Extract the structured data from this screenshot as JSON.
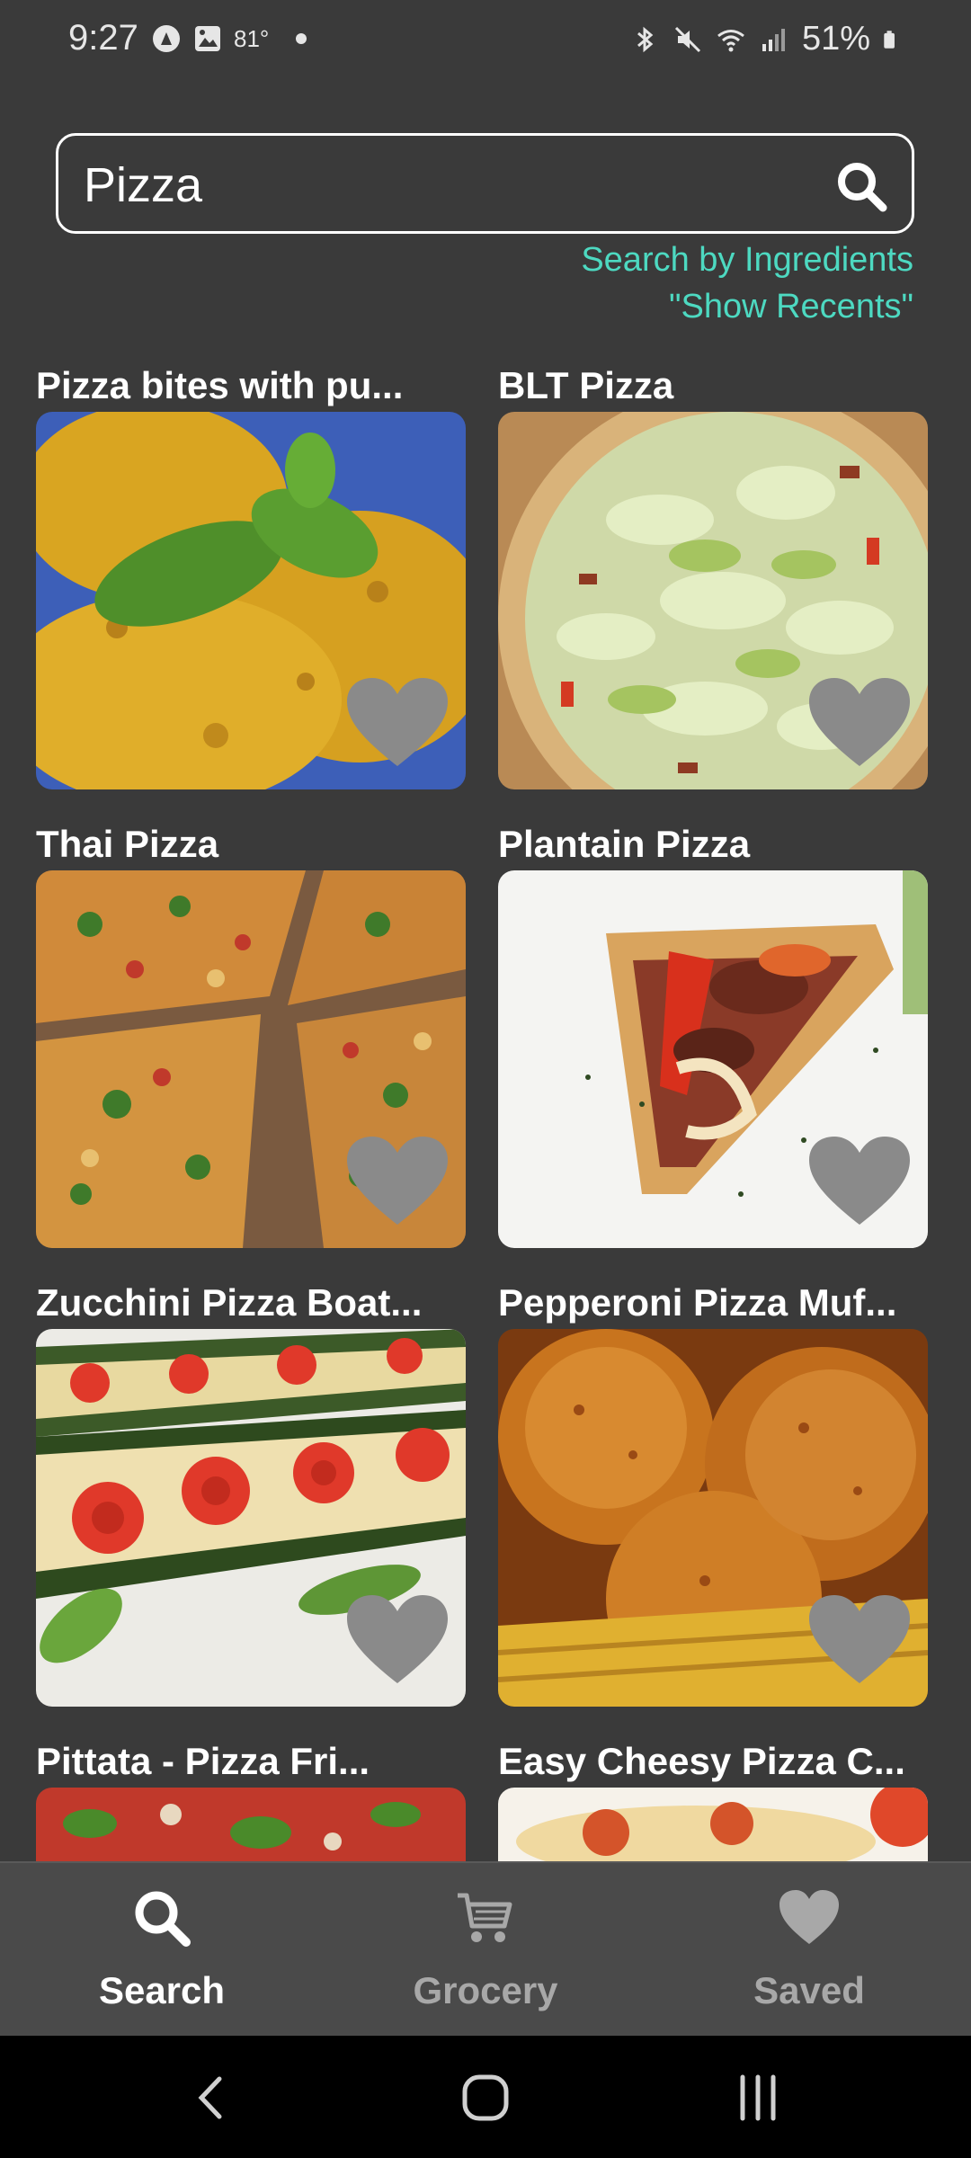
{
  "status": {
    "time": "9:27",
    "temp": "81°",
    "battery": "51%"
  },
  "search": {
    "value": "Pizza",
    "by_ingredients": "Search by Ingredients",
    "show_recents": "\"Show Recents\""
  },
  "recipes": [
    {
      "title": "Pizza bites with pu..."
    },
    {
      "title": "BLT Pizza"
    },
    {
      "title": "Thai Pizza"
    },
    {
      "title": "Plantain Pizza"
    },
    {
      "title": "Zucchini Pizza Boat..."
    },
    {
      "title": "Pepperoni Pizza Muf..."
    },
    {
      "title": "Pittata - Pizza Fri..."
    },
    {
      "title": "Easy Cheesy Pizza C..."
    }
  ],
  "nav": {
    "search": "Search",
    "grocery": "Grocery",
    "saved": "Saved"
  },
  "colors": {
    "background": "#3a3a3a",
    "accent": "#4dd9c1",
    "nav_active": "#ffffff",
    "nav_inactive": "#a8a8a8",
    "heart": "#8a8a8a"
  }
}
